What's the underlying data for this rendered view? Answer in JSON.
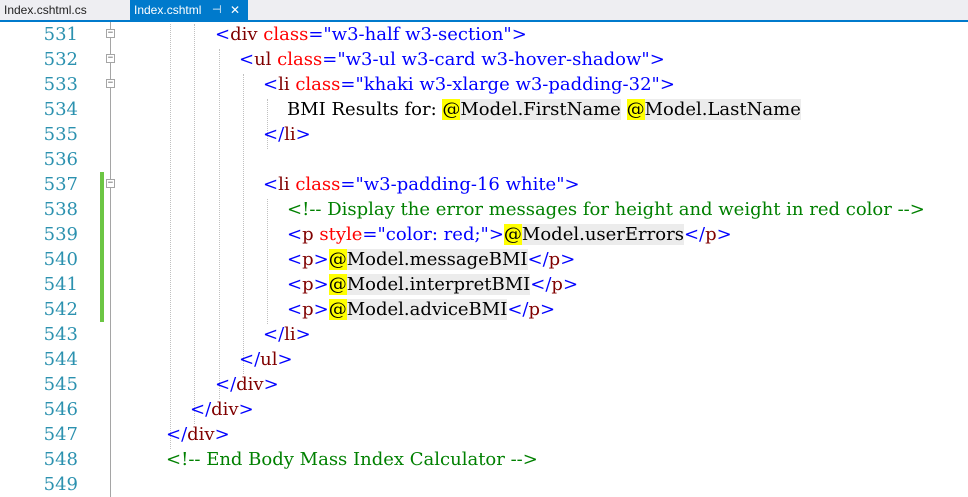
{
  "tabs": [
    {
      "label": "Index.cshtml.cs",
      "active": false
    },
    {
      "label": "Index.cshtml",
      "active": true,
      "pin": "⊣",
      "close": "✕"
    }
  ],
  "colors": {
    "tag": "#800000",
    "delim": "#0000ff",
    "attr": "#ff0000",
    "value": "#0000ff",
    "comment": "#008000",
    "line_number": "#2b91af",
    "razor_at": "#ffff00",
    "tab_accent": "#007acc"
  },
  "lines": [
    {
      "num": "531",
      "tokens": [
        [
          "delim",
          "<"
        ],
        [
          "tag",
          "div"
        ],
        [
          "attr",
          " class"
        ],
        [
          "delim",
          "="
        ],
        [
          "val",
          "\"w3-half w3-section\""
        ],
        [
          "delim",
          ">"
        ]
      ]
    },
    {
      "num": "532",
      "tokens": [
        [
          "delim",
          "<"
        ],
        [
          "tag",
          "ul"
        ],
        [
          "attr",
          " class"
        ],
        [
          "delim",
          "="
        ],
        [
          "val",
          "\"w3-ul w3-card w3-hover-shadow\""
        ],
        [
          "delim",
          ">"
        ]
      ]
    },
    {
      "num": "533",
      "tokens": [
        [
          "delim",
          "<"
        ],
        [
          "tag",
          "li"
        ],
        [
          "attr",
          " class"
        ],
        [
          "delim",
          "="
        ],
        [
          "val",
          "\"khaki w3-xlarge w3-padding-32\""
        ],
        [
          "delim",
          ">"
        ]
      ]
    },
    {
      "num": "534",
      "tokens": [
        [
          "text",
          "BMI Results for: "
        ],
        [
          "at",
          "@"
        ],
        [
          "razor",
          "Model.FirstName"
        ],
        [
          "text",
          " "
        ],
        [
          "at",
          "@"
        ],
        [
          "razor",
          "Model.LastName"
        ]
      ]
    },
    {
      "num": "535",
      "tokens": [
        [
          "delim",
          "</"
        ],
        [
          "tag",
          "li"
        ],
        [
          "delim",
          ">"
        ]
      ]
    },
    {
      "num": "536",
      "tokens": []
    },
    {
      "num": "537",
      "tokens": [
        [
          "delim",
          "<"
        ],
        [
          "tag",
          "li"
        ],
        [
          "attr",
          " class"
        ],
        [
          "delim",
          "="
        ],
        [
          "val",
          "\"w3-padding-16 white\""
        ],
        [
          "delim",
          ">"
        ]
      ]
    },
    {
      "num": "538",
      "tokens": [
        [
          "comment",
          "<!-- Display the error messages for height and weight in red color -->"
        ]
      ]
    },
    {
      "num": "539",
      "tokens": [
        [
          "delim",
          "<"
        ],
        [
          "tag",
          "p"
        ],
        [
          "attr",
          " style"
        ],
        [
          "delim",
          "="
        ],
        [
          "val",
          "\"color: red;\""
        ],
        [
          "delim",
          ">"
        ],
        [
          "at",
          "@"
        ],
        [
          "razor",
          "Model.userErrors"
        ],
        [
          "delim",
          "</"
        ],
        [
          "tag",
          "p"
        ],
        [
          "delim",
          ">"
        ]
      ]
    },
    {
      "num": "540",
      "tokens": [
        [
          "delim",
          "<"
        ],
        [
          "tag",
          "p"
        ],
        [
          "delim",
          ">"
        ],
        [
          "at",
          "@"
        ],
        [
          "razor",
          "Model.messageBMI"
        ],
        [
          "delim",
          "</"
        ],
        [
          "tag",
          "p"
        ],
        [
          "delim",
          ">"
        ]
      ]
    },
    {
      "num": "541",
      "tokens": [
        [
          "delim",
          "<"
        ],
        [
          "tag",
          "p"
        ],
        [
          "delim",
          ">"
        ],
        [
          "at",
          "@"
        ],
        [
          "razor",
          "Model.interpretBMI"
        ],
        [
          "delim",
          "</"
        ],
        [
          "tag",
          "p"
        ],
        [
          "delim",
          ">"
        ]
      ]
    },
    {
      "num": "542",
      "tokens": [
        [
          "delim",
          "<"
        ],
        [
          "tag",
          "p"
        ],
        [
          "delim",
          ">"
        ],
        [
          "at",
          "@"
        ],
        [
          "razor",
          "Model.adviceBMI"
        ],
        [
          "delim",
          "</"
        ],
        [
          "tag",
          "p"
        ],
        [
          "delim",
          ">"
        ]
      ]
    },
    {
      "num": "543",
      "tokens": [
        [
          "delim",
          "</"
        ],
        [
          "tag",
          "li"
        ],
        [
          "delim",
          ">"
        ]
      ]
    },
    {
      "num": "544",
      "tokens": [
        [
          "delim",
          "</"
        ],
        [
          "tag",
          "ul"
        ],
        [
          "delim",
          ">"
        ]
      ]
    },
    {
      "num": "545",
      "tokens": [
        [
          "delim",
          "</"
        ],
        [
          "tag",
          "div"
        ],
        [
          "delim",
          ">"
        ]
      ]
    },
    {
      "num": "546",
      "tokens": [
        [
          "delim",
          "</"
        ],
        [
          "tag",
          "div"
        ],
        [
          "delim",
          ">"
        ]
      ]
    },
    {
      "num": "547",
      "tokens": [
        [
          "delim",
          "</"
        ],
        [
          "tag",
          "div"
        ],
        [
          "delim",
          ">"
        ]
      ]
    },
    {
      "num": "548",
      "tokens": [
        [
          "comment",
          "<!-- End Body Mass Index Calculator -->"
        ]
      ]
    },
    {
      "num": "549",
      "tokens": []
    }
  ]
}
